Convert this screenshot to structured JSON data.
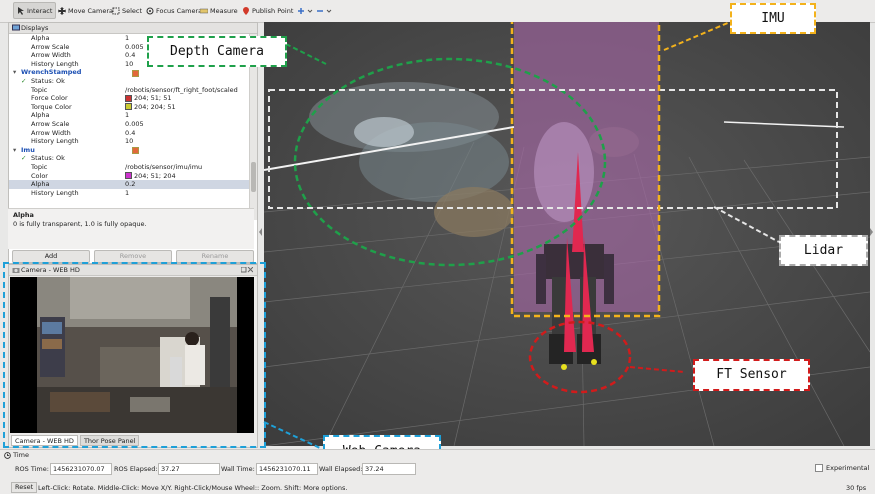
{
  "toolbar": {
    "items": [
      "Interact",
      "Move Camera",
      "Select",
      "Focus Camera",
      "Measure",
      "Publish Point"
    ]
  },
  "displays": {
    "title": "Displays",
    "rows": [
      {
        "k": "Alpha",
        "v": "1"
      },
      {
        "k": "Arrow Scale",
        "v": "0.005"
      },
      {
        "k": "Arrow Width",
        "v": "0.4"
      },
      {
        "k": "History Length",
        "v": "10"
      },
      {
        "k": "WrenchStamped",
        "v": ""
      },
      {
        "k": "Status: Ok",
        "v": ""
      },
      {
        "k": "Topic",
        "v": "/robotis/sensor/ft_right_foot/scaled"
      },
      {
        "k": "Force Color",
        "v": "204; 51; 51"
      },
      {
        "k": "Torque Color",
        "v": "204; 204; 51"
      },
      {
        "k": "Alpha",
        "v": "1"
      },
      {
        "k": "Arrow Scale",
        "v": "0.005"
      },
      {
        "k": "Arrow Width",
        "v": "0.4"
      },
      {
        "k": "History Length",
        "v": "10"
      },
      {
        "k": "Imu",
        "v": ""
      },
      {
        "k": "Status: Ok",
        "v": ""
      },
      {
        "k": "Topic",
        "v": "/robotis/sensor/imu/imu"
      },
      {
        "k": "Color",
        "v": "204; 51; 204"
      },
      {
        "k": "Alpha",
        "v": "0.2"
      },
      {
        "k": "History Length",
        "v": "1"
      }
    ],
    "desc_title": "Alpha",
    "desc_text": "0 is fully transparent, 1.0 is fully opaque.",
    "buttons": [
      "Add",
      "Remove",
      "Rename"
    ]
  },
  "camera_panel": {
    "title": "Camera - WEB HD",
    "tabs": [
      "Camera - WEB HD",
      "Thor Pose Panel"
    ]
  },
  "callouts": {
    "depth": "Depth Camera",
    "imu": "IMU",
    "lidar": "Lidar",
    "ft": "FT Sensor",
    "web": "Web Camera"
  },
  "time": {
    "title": "Time",
    "ros_time_label": "ROS Time:",
    "ros_time": "1456231070.07",
    "ros_elapsed_label": "ROS Elapsed:",
    "ros_elapsed": "37.27",
    "wall_time_label": "Wall Time:",
    "wall_time": "1456231070.11",
    "wall_elapsed_label": "Wall Elapsed:",
    "wall_elapsed": "37.24",
    "experimental": "Experimental",
    "reset": "Reset",
    "hint": "Left-Click: Rotate. Middle-Click: Move X/Y. Right-Click/Mouse Wheel:: Zoom. Shift: More options.",
    "fps": "30 fps"
  },
  "colors": {
    "force": "#cc3333",
    "torque": "#cccc33",
    "imu": "#cc33cc",
    "green": "#1fa04a",
    "yellow": "#f3b21c",
    "red": "#d11b1b",
    "cyan": "#1ea0d8"
  }
}
